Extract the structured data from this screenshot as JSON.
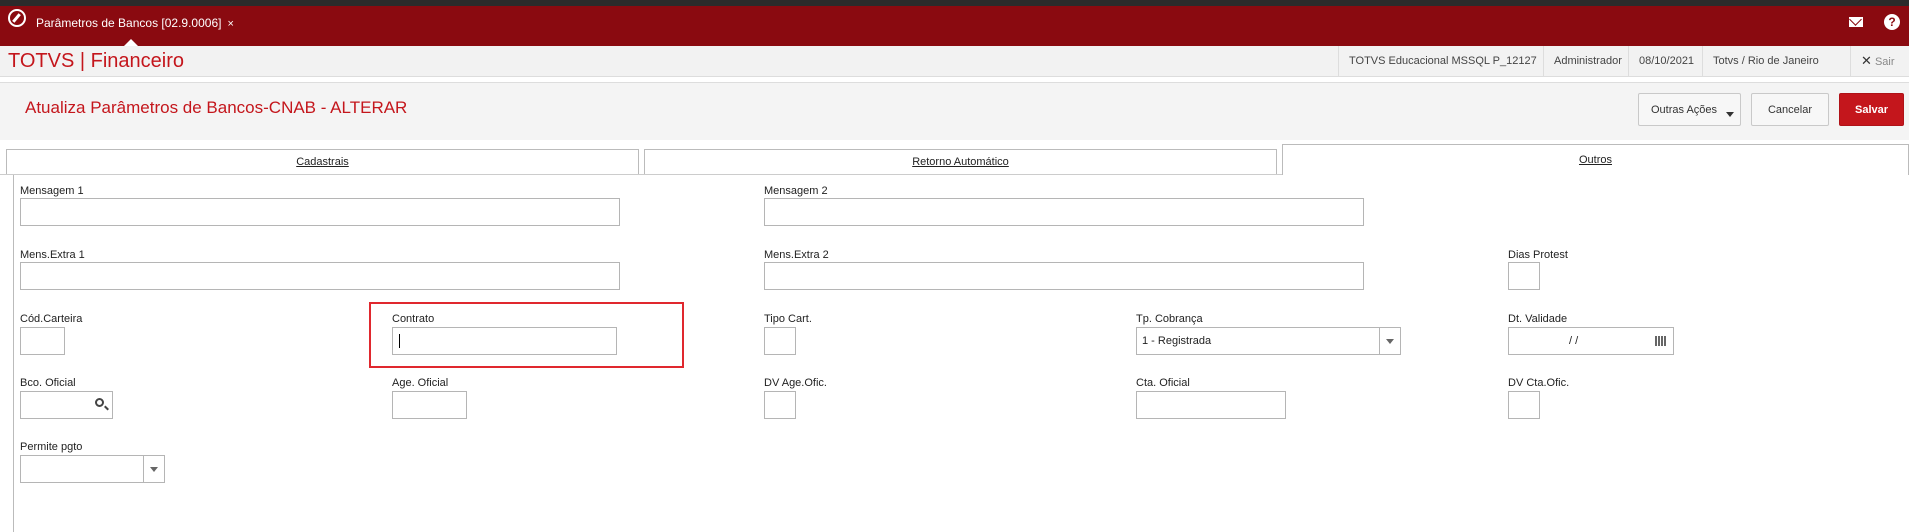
{
  "window": {
    "tab_label": "Parâmetros de Bancos [02.9.0006]",
    "tab_close": "×",
    "help": "?"
  },
  "header": {
    "brand": "TOTVS | Financeiro",
    "environment": "TOTVS Educacional MSSQL P_12127",
    "user": "Administrador",
    "date": "08/10/2021",
    "branch": "Totvs / Rio de Janeiro",
    "exit_label": "Sair"
  },
  "form": {
    "title": "Atualiza Parâmetros de Bancos-CNAB - ALTERAR",
    "actions": {
      "other": "Outras Ações",
      "cancel": "Cancelar",
      "save": "Salvar"
    },
    "tabs": [
      "Cadastrais",
      "Retorno Automático",
      "Outros"
    ],
    "active_tab": "Outros"
  },
  "fields": {
    "mensagem1": {
      "label": "Mensagem 1",
      "value": ""
    },
    "mensagem2": {
      "label": "Mensagem 2",
      "value": ""
    },
    "mens_extra1": {
      "label": "Mens.Extra 1",
      "value": ""
    },
    "mens_extra2": {
      "label": "Mens.Extra 2",
      "value": ""
    },
    "dias_protest": {
      "label": "Dias Protest",
      "value": ""
    },
    "cod_carteira": {
      "label": "Cód.Carteira",
      "value": ""
    },
    "contrato": {
      "label": "Contrato",
      "value": ""
    },
    "tipo_cart": {
      "label": "Tipo Cart.",
      "value": ""
    },
    "tp_cobranca": {
      "label": "Tp. Cobrança",
      "value": "1 - Registrada"
    },
    "dt_validade": {
      "label": "Dt. Validade",
      "value": "/ /"
    },
    "bco_oficial": {
      "label": "Bco. Oficial",
      "value": ""
    },
    "age_oficial": {
      "label": "Age. Oficial",
      "value": ""
    },
    "dv_age_ofic": {
      "label": "DV Age.Ofic.",
      "value": ""
    },
    "cta_oficial": {
      "label": "Cta. Oficial",
      "value": ""
    },
    "dv_cta_ofic": {
      "label": "DV Cta.Ofic.",
      "value": ""
    },
    "permite_pgto": {
      "label": "Permite pgto",
      "value": ""
    }
  },
  "colors": {
    "brand_red": "#8a0a10",
    "accent_red": "#c4161c"
  }
}
